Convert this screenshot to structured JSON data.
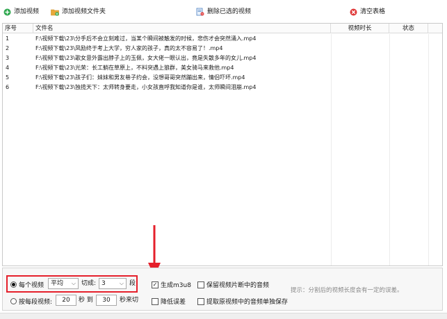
{
  "toolbar": {
    "add_video": "添加视频",
    "add_folder": "添加视频文件夹",
    "delete_selected": "删除已选的视频",
    "clear_table": "清空表格"
  },
  "table": {
    "headers": {
      "no": "序号",
      "filename": "文件名",
      "duration": "视频时长",
      "status": "状态"
    },
    "rows": [
      {
        "no": "1",
        "filename": "F:\\视频下载\\23\\分手后不会立刻难过，当某个瞬间被触发的时候，悲伤才会突然涌入.mp4"
      },
      {
        "no": "2",
        "filename": "F:\\视频下载\\23\\凤励终于考上大学，穷人家的孩子，真的太不容易了！.mp4"
      },
      {
        "no": "3",
        "filename": "F:\\视频下载\\23\\歌女意外露出脖子上的玉佩，女大佬一眼认出，竟是失散多年的女儿.mp4"
      },
      {
        "no": "4",
        "filename": "F:\\视频下载\\23\\光荣：长工躺在草原上，不料突遇上狼群，美女骑马来救他.mp4"
      },
      {
        "no": "5",
        "filename": "F:\\视频下载\\23\\孩子们：妹妹和男友巷子约会，没想哥哥突然蹦出来，情侣吓坏.mp4"
      },
      {
        "no": "6",
        "filename": "F:\\视频下载\\23\\独揽天下：太师转身要走，小女孩直呼我知道你是谁，太师瞬间泪崩.mp4"
      }
    ]
  },
  "options": {
    "per_video_label": "每个视频",
    "mode_value": "平均",
    "cut_label": "切成:",
    "count_value": "3",
    "seg_unit": "段",
    "per_seg_label": "按每段视频:",
    "from_value": "20",
    "sec_to": "秒 到",
    "to_value": "30",
    "sec_cut": "秒来切",
    "gen_m3u8": "生成m3u8",
    "reduce_error": "降低误差",
    "keep_audio": "保留视频片断中的音频",
    "extract_audio": "提取原视频中的音频单独保存",
    "hint": "提示：分割后的视频长度会有一定的误差。"
  },
  "colors": {
    "add_icon": "#2fa84f",
    "folder_icon": "#e8a93a",
    "clear_icon": "#e03a3a",
    "annotation": "#e5202b"
  }
}
